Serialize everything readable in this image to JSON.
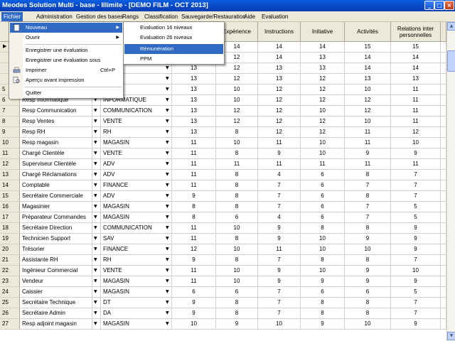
{
  "window": {
    "title": "Meodes Solution Multi - base - Illimite - [DEMO FILM - OCT 2013]",
    "min": "_",
    "max": "□",
    "close": "×"
  },
  "menubar": [
    "Fichier",
    "Administration",
    "Gestion des bases",
    "Rangs",
    "Classification",
    "Sauvegarde/Restauration",
    "Aide",
    "Evaluation"
  ],
  "grid": {
    "headers": [
      "Expérience",
      "Instructions",
      "Initiative",
      "Activités",
      "Relations inter personnelles"
    ],
    "rows": [
      {
        "idx": "",
        "name": "",
        "dept": "",
        "vals": [
          "",
          "14",
          "14",
          "14",
          "15",
          "15"
        ]
      },
      {
        "idx": "",
        "name": "",
        "dept": "",
        "vals": [
          "13",
          "12",
          "14",
          "13",
          "14",
          "14"
        ]
      },
      {
        "idx": "",
        "name": "",
        "dept": "",
        "vals": [
          "13",
          "12",
          "13",
          "13",
          "14",
          "14"
        ]
      },
      {
        "idx": "",
        "name": "",
        "dept": "",
        "vals": [
          "13",
          "12",
          "13",
          "12",
          "13",
          "13"
        ]
      },
      {
        "idx": "5",
        "name": "Resp ADV",
        "dept": "ADV",
        "vals": [
          "13",
          "10",
          "12",
          "12",
          "10",
          "11"
        ]
      },
      {
        "idx": "6",
        "name": "Resp Informatique",
        "dept": "INFORMATIQUE",
        "vals": [
          "13",
          "10",
          "12",
          "12",
          "12",
          "11"
        ]
      },
      {
        "idx": "7",
        "name": "Resp Communication",
        "dept": "COMMUNICATION",
        "vals": [
          "13",
          "12",
          "12",
          "10",
          "12",
          "11"
        ]
      },
      {
        "idx": "8",
        "name": "Resp Ventes",
        "dept": "VENTE",
        "vals": [
          "13",
          "12",
          "12",
          "12",
          "10",
          "11"
        ]
      },
      {
        "idx": "9",
        "name": "Resp RH",
        "dept": "RH",
        "vals": [
          "13",
          "8",
          "12",
          "12",
          "11",
          "12"
        ]
      },
      {
        "idx": "10",
        "name": "Resp magasin",
        "dept": "MAGASIN",
        "vals": [
          "11",
          "10",
          "11",
          "10",
          "11",
          "10"
        ]
      },
      {
        "idx": "11",
        "name": "Chargé Clientèle",
        "dept": "VENTE",
        "vals": [
          "11",
          "8",
          "9",
          "10",
          "9",
          "9"
        ]
      },
      {
        "idx": "12",
        "name": "Superviseur Clientèle",
        "dept": "ADV",
        "vals": [
          "11",
          "11",
          "11",
          "11",
          "11",
          "11"
        ]
      },
      {
        "idx": "13",
        "name": "Chargé Réclamations",
        "dept": "ADV",
        "vals": [
          "11",
          "8",
          "4",
          "6",
          "8",
          "7"
        ]
      },
      {
        "idx": "14",
        "name": "Comptable",
        "dept": "FINANCE",
        "vals": [
          "11",
          "8",
          "7",
          "6",
          "7",
          "7"
        ]
      },
      {
        "idx": "15",
        "name": "Secrétaire Commerciale",
        "dept": "ADV",
        "vals": [
          "9",
          "8",
          "7",
          "6",
          "8",
          "7"
        ]
      },
      {
        "idx": "16",
        "name": "Magasinier",
        "dept": "MAGASIN",
        "vals": [
          "8",
          "8",
          "7",
          "6",
          "7",
          "5"
        ]
      },
      {
        "idx": "17",
        "name": "Préparateur Commandes",
        "dept": "MAGASIN",
        "vals": [
          "8",
          "6",
          "4",
          "6",
          "7",
          "5"
        ]
      },
      {
        "idx": "18",
        "name": "Secrétaire Direction",
        "dept": "COMMUNICATION",
        "vals": [
          "11",
          "10",
          "9",
          "8",
          "8",
          "9"
        ]
      },
      {
        "idx": "19",
        "name": "Technicien Support",
        "dept": "SAV",
        "vals": [
          "11",
          "8",
          "9",
          "10",
          "9",
          "9"
        ]
      },
      {
        "idx": "20",
        "name": "Trésorier",
        "dept": "FINANCE",
        "vals": [
          "12",
          "10",
          "11",
          "10",
          "10",
          "9"
        ]
      },
      {
        "idx": "21",
        "name": "Assistante RH",
        "dept": "RH",
        "vals": [
          "9",
          "8",
          "7",
          "8",
          "8",
          "7"
        ]
      },
      {
        "idx": "22",
        "name": "Ingénieur Commercial",
        "dept": "VENTE",
        "vals": [
          "11",
          "10",
          "9",
          "10",
          "9",
          "10"
        ]
      },
      {
        "idx": "23",
        "name": "Vendeur",
        "dept": "MAGASIN",
        "vals": [
          "11",
          "10",
          "9",
          "9",
          "9",
          "9"
        ]
      },
      {
        "idx": "24",
        "name": "Caissier",
        "dept": "MAGASIN",
        "vals": [
          "6",
          "6",
          "7",
          "6",
          "6",
          "5"
        ]
      },
      {
        "idx": "25",
        "name": "Secrétaire Technique",
        "dept": "DT",
        "vals": [
          "9",
          "8",
          "7",
          "8",
          "8",
          "7"
        ]
      },
      {
        "idx": "26",
        "name": "Secrétaire Admin",
        "dept": "DA",
        "vals": [
          "9",
          "8",
          "7",
          "8",
          "8",
          "7"
        ]
      },
      {
        "idx": "27",
        "name": "Resp adjoint magasin",
        "dept": "MAGASIN",
        "vals": [
          "10",
          "9",
          "10",
          "9",
          "10",
          "9"
        ]
      }
    ]
  },
  "fichier_menu": {
    "nouveau": "Nouveau",
    "ouvrir": "Ouvrir",
    "enregistrer": "Enregistrer une évaluation",
    "enregistrer_sous": "Enregistrer une évaluation sous",
    "imprimer": "Imprimer",
    "imprimer_shortcut": "Ctrl+P",
    "apercu": "Aperçu avant impression",
    "quitter": "Quitter"
  },
  "nouveau_submenu": [
    "Evaluation 16 niveaux",
    "Evaluation 26 niveaux",
    "Rémunération",
    "PPM"
  ],
  "colors": {
    "highlight": "#316ac5",
    "titlebar": "#0a5fe0"
  }
}
